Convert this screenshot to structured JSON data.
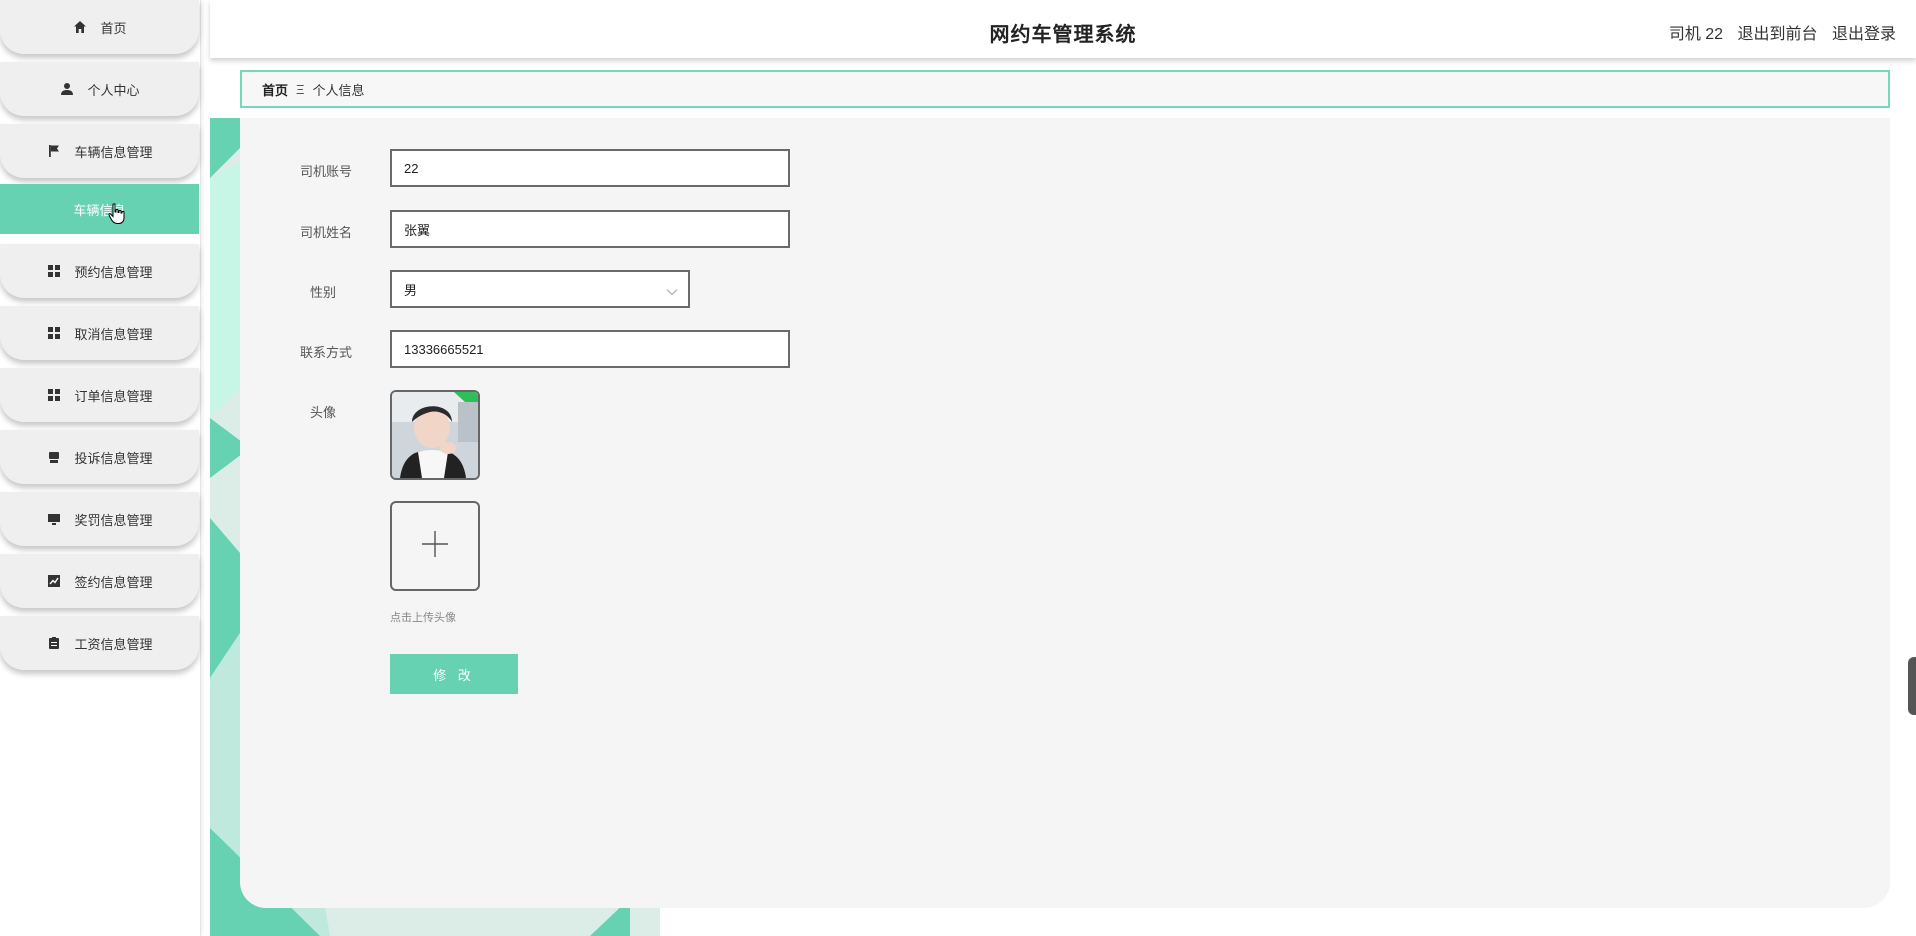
{
  "sidebar": {
    "items": [
      {
        "label": "首页",
        "icon": "home-icon"
      },
      {
        "label": "个人中心",
        "icon": "user-icon"
      },
      {
        "label": "车辆信息管理",
        "icon": "flag-icon"
      },
      {
        "label": "车辆信息",
        "icon": ""
      },
      {
        "label": "预约信息管理",
        "icon": "grid-icon"
      },
      {
        "label": "取消信息管理",
        "icon": "grid-icon"
      },
      {
        "label": "订单信息管理",
        "icon": "grid-icon"
      },
      {
        "label": "投诉信息管理",
        "icon": "printer-icon"
      },
      {
        "label": "奖罚信息管理",
        "icon": "monitor-icon"
      },
      {
        "label": "签约信息管理",
        "icon": "chart-icon"
      },
      {
        "label": "工资信息管理",
        "icon": "clipboard-icon"
      }
    ]
  },
  "header": {
    "title": "网约车管理系统",
    "user_label": "司机 22",
    "back_label": "退出到前台",
    "logout_label": "退出登录"
  },
  "breadcrumb": {
    "home": "首页",
    "separator": "Ξ",
    "current": "个人信息"
  },
  "form": {
    "account": {
      "label": "司机账号",
      "value": "22"
    },
    "name": {
      "label": "司机姓名",
      "value": "张翼"
    },
    "gender": {
      "label": "性别",
      "value": "男"
    },
    "phone": {
      "label": "联系方式",
      "value": "13336665521"
    },
    "avatar": {
      "label": "头像"
    },
    "upload_tip": "点击上传头像",
    "submit_label": "修 改"
  },
  "colors": {
    "accent": "#66d2b2",
    "breadcrumb_border": "#74d8ba",
    "card_bg": "#f6f5f6"
  }
}
